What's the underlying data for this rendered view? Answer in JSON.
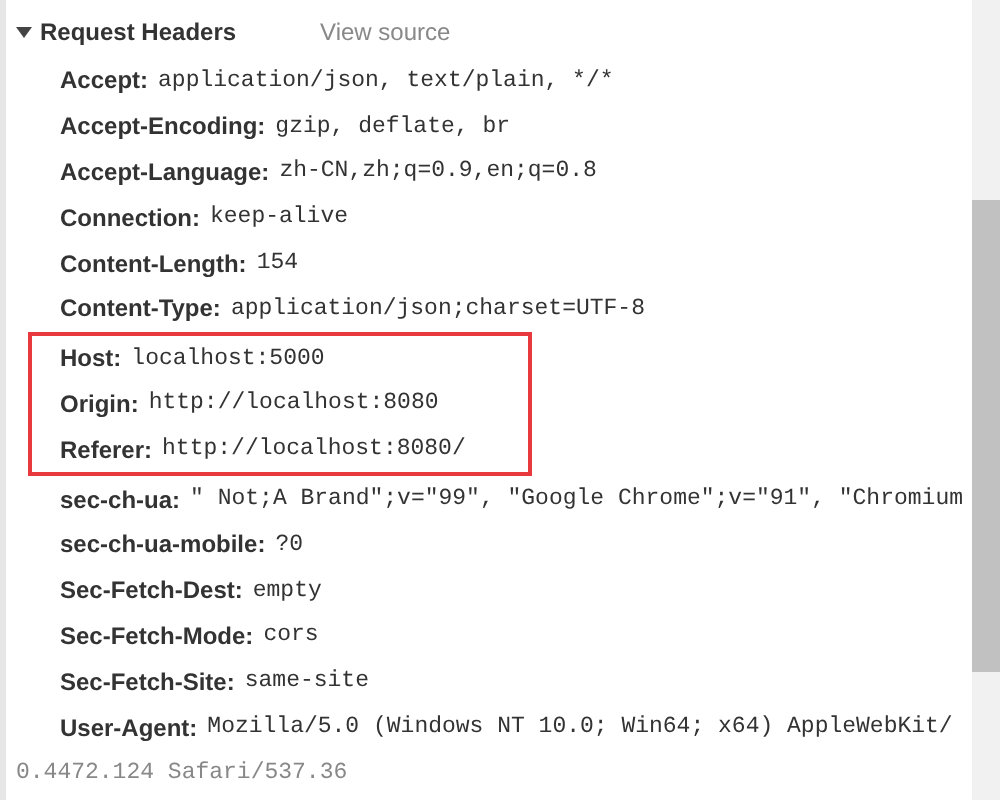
{
  "section": {
    "title": "Request Headers",
    "expanded": true,
    "link": "View source"
  },
  "headers": [
    {
      "name": "Accept:",
      "value": "application/json, text/plain, */*",
      "highlighted": false
    },
    {
      "name": "Accept-Encoding:",
      "value": "gzip, deflate, br",
      "highlighted": false
    },
    {
      "name": "Accept-Language:",
      "value": "zh-CN,zh;q=0.9,en;q=0.8",
      "highlighted": false
    },
    {
      "name": "Connection:",
      "value": "keep-alive",
      "highlighted": false
    },
    {
      "name": "Content-Length:",
      "value": "154",
      "highlighted": false
    },
    {
      "name": "Content-Type:",
      "value": "application/json;charset=UTF-8",
      "highlighted": false
    },
    {
      "name": "Host:",
      "value": "localhost:5000",
      "highlighted": true
    },
    {
      "name": "Origin:",
      "value": "http://localhost:8080",
      "highlighted": true
    },
    {
      "name": "Referer:",
      "value": "http://localhost:8080/",
      "highlighted": true
    },
    {
      "name": "sec-ch-ua:",
      "value": "\" Not;A Brand\";v=\"99\", \"Google Chrome\";v=\"91\", \"Chromium",
      "highlighted": false
    },
    {
      "name": "sec-ch-ua-mobile:",
      "value": "?0",
      "highlighted": false
    },
    {
      "name": "Sec-Fetch-Dest:",
      "value": "empty",
      "highlighted": false
    },
    {
      "name": "Sec-Fetch-Mode:",
      "value": "cors",
      "highlighted": false
    },
    {
      "name": "Sec-Fetch-Site:",
      "value": "same-site",
      "highlighted": false
    },
    {
      "name": "User-Agent:",
      "value": "Mozilla/5.0 (Windows NT 10.0; Win64; x64) AppleWebKit/",
      "continuation": "0.4472.124 Safari/537.36",
      "highlighted": false
    }
  ]
}
